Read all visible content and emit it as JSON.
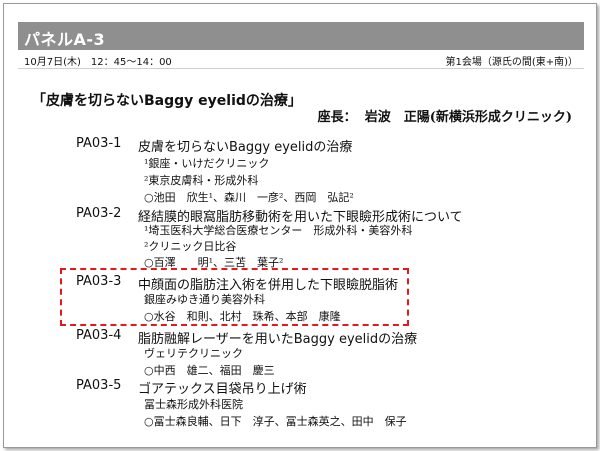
{
  "header": {
    "title": "パネルA-3"
  },
  "subbar": {
    "date_time": "10月7日(木)　12：45～14：00",
    "room": "第1会場（源氏の間(東+南)）"
  },
  "session": {
    "title": "「皮膚を切らないBaggy eyelidの治療」"
  },
  "chair": {
    "label": "座長：",
    "name": "岩波　正陽(新横浜形成クリニック)"
  },
  "presentations": [
    {
      "id": "PA03-1",
      "title": "皮膚を切らないBaggy eyelidの治療",
      "lines": [
        "¹銀座・いけだクリニック",
        "²東京皮膚科・形成外科",
        "○池田　欣生¹、森川　一彦²、西岡　弘記²"
      ]
    },
    {
      "id": "PA03-2",
      "title": "経結膜的眼窩脂肪移動術を用いた下眼瞼形成術について",
      "lines": [
        "¹埼玉医科大学総合医療センター　形成外科・美容外科",
        "²クリニック日比谷",
        "○百澤　　明¹、三苫　葉子²"
      ]
    },
    {
      "id": "PA03-3",
      "title": "中顔面の脂肪注入術を併用した下眼瞼脱脂術",
      "lines": [
        "銀座みゆき通り美容外科",
        "○水谷　和則、北村　珠希、本部　康隆"
      ]
    },
    {
      "id": "PA03-4",
      "title": "脂肪融解レーザーを用いたBaggy eyelidの治療",
      "lines": [
        "ヴェリテクリニック",
        "○中西　雄二、福田　慶三"
      ]
    },
    {
      "id": "PA03-5",
      "title": "ゴアテックス目袋吊り上げ術",
      "lines": [
        "冨士森形成外科医院",
        "○冨士森良輔、日下　淳子、冨士森英之、田中　保子"
      ]
    }
  ],
  "colors": {
    "header_bg": "#8f8f8f",
    "highlight": "#e41a1a"
  }
}
